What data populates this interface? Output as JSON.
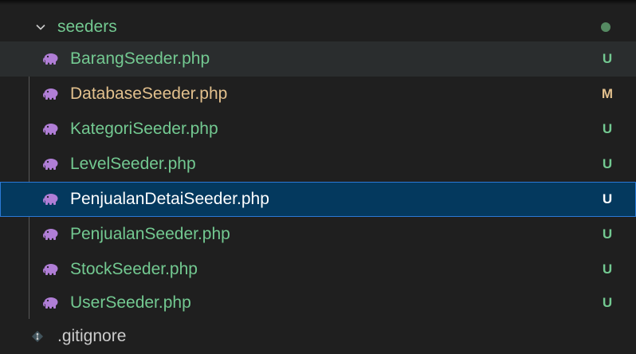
{
  "colors": {
    "untracked": "#73c991",
    "modified": "#e2c08d",
    "selected_text": "#ffffff",
    "selection_bg": "#04395e",
    "php_icon": "#b07ed6"
  },
  "folder": {
    "name": "seeders",
    "icon": "chevron-down-icon"
  },
  "files": [
    {
      "name": "BarangSeeder.php",
      "status": "U",
      "icon": "php-elephant-icon"
    },
    {
      "name": "DatabaseSeeder.php",
      "status": "M",
      "icon": "php-elephant-icon"
    },
    {
      "name": "KategoriSeeder.php",
      "status": "U",
      "icon": "php-elephant-icon"
    },
    {
      "name": "LevelSeeder.php",
      "status": "U",
      "icon": "php-elephant-icon"
    },
    {
      "name": "PenjualanDetaiSeeder.php",
      "status": "U",
      "icon": "php-elephant-icon"
    },
    {
      "name": "PenjualanSeeder.php",
      "status": "U",
      "icon": "php-elephant-icon"
    },
    {
      "name": "StockSeeder.php",
      "status": "U",
      "icon": "php-elephant-icon"
    },
    {
      "name": "UserSeeder.php",
      "status": "U",
      "icon": "php-elephant-icon"
    }
  ],
  "gitignore": {
    "name": ".gitignore",
    "icon": "git-diamond-icon"
  }
}
